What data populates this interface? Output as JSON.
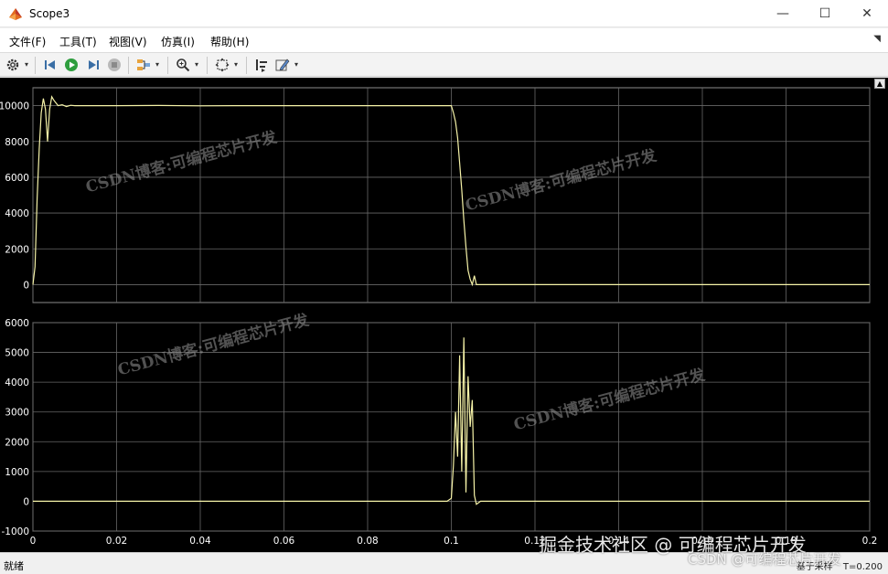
{
  "window": {
    "title": "Scope3",
    "minimize": "—",
    "maximize": "☐",
    "close": "✕"
  },
  "menu": [
    {
      "label": "文件(F)"
    },
    {
      "label": "工具(T)"
    },
    {
      "label": "视图(V)"
    },
    {
      "label": "仿真(I)"
    },
    {
      "label": "帮助(H)"
    }
  ],
  "menu_corner": "◥",
  "toolbar": {
    "icons": [
      "gear-icon",
      "step-back-icon",
      "run-icon",
      "step-forward-icon",
      "stop-icon",
      "signal-highlight-icon",
      "zoom-icon",
      "fit-to-view-icon",
      "cursor-measure-icon",
      "style-pen-icon"
    ]
  },
  "colors": {
    "trace": "#f6f3a8",
    "grid": "#686868",
    "axes_bg": "#000000",
    "tick_text": "#ffffff"
  },
  "chart_data": [
    {
      "type": "line",
      "title": "",
      "xlabel": "",
      "ylabel": "",
      "xlim": [
        0,
        0.2
      ],
      "ylim": [
        -1000,
        11000
      ],
      "xticks": [
        0,
        0.02,
        0.04,
        0.06,
        0.08,
        0.1,
        0.12,
        0.14,
        0.16,
        0.18,
        0.2
      ],
      "yticks": [
        0,
        2000,
        4000,
        6000,
        8000,
        10000
      ],
      "grid": true,
      "series": [
        {
          "x": [
            0,
            0.0005,
            0.001,
            0.0015,
            0.002,
            0.0025,
            0.003,
            0.0035,
            0.004,
            0.0045,
            0.005,
            0.0055,
            0.006,
            0.007,
            0.008,
            0.009,
            0.01,
            0.02,
            0.03,
            0.04,
            0.05,
            0.06,
            0.07,
            0.08,
            0.09,
            0.1,
            0.1005,
            0.101,
            0.1015,
            0.102,
            0.1025,
            0.103,
            0.1035,
            0.104,
            0.1045,
            0.105,
            0.1055,
            0.106,
            0.11,
            0.12,
            0.14,
            0.16,
            0.18,
            0.2
          ],
          "y": [
            0,
            1000,
            4800,
            7600,
            9600,
            10400,
            9800,
            8000,
            9800,
            10500,
            10300,
            10150,
            10000,
            10050,
            9950,
            10020,
            10000,
            10000,
            10010,
            9990,
            10000,
            10000,
            10000,
            10000,
            10000,
            10000,
            9600,
            9100,
            8200,
            6800,
            5300,
            3600,
            2100,
            800,
            300,
            0,
            500,
            0,
            0,
            0,
            0,
            0,
            0,
            0
          ]
        }
      ]
    },
    {
      "type": "line",
      "title": "",
      "xlabel": "",
      "ylabel": "",
      "xlim": [
        0,
        0.2
      ],
      "ylim": [
        -1000,
        6000
      ],
      "xticks": [
        0,
        0.02,
        0.04,
        0.06,
        0.08,
        0.1,
        0.12,
        0.14,
        0.16,
        0.18,
        0.2
      ],
      "x_tick_labels": [
        "0",
        "0.02",
        "0.04",
        "0.06",
        "0.08",
        "0.1",
        "0.12",
        "0.14",
        "0.16",
        "0.18",
        "0.2"
      ],
      "yticks": [
        -1000,
        0,
        1000,
        2000,
        3000,
        4000,
        5000,
        6000
      ],
      "grid": true,
      "series": [
        {
          "x": [
            0,
            0.099,
            0.1,
            0.1005,
            0.101,
            0.1015,
            0.102,
            0.1025,
            0.103,
            0.1035,
            0.104,
            0.1045,
            0.105,
            0.1055,
            0.106,
            0.107,
            0.12,
            0.2
          ],
          "y": [
            0,
            0,
            100,
            1200,
            3000,
            1500,
            4900,
            1000,
            5500,
            300,
            4200,
            2500,
            3400,
            200,
            -100,
            0,
            0,
            0
          ]
        }
      ]
    }
  ],
  "status": {
    "left": "就绪",
    "right_mode": "基于采样",
    "right_time": "T=0.200"
  },
  "watermarks": {
    "plot": [
      "CSDN博客:可编程芯片开发",
      "CSDN博客:可编程芯片开发",
      "CSDN博客:可编程芯片开发",
      "CSDN博客:可编程芯片开发"
    ],
    "site": "掘金技术社区 @ 可编程芯片开发",
    "site2": "CSDN @可编程芯片开发"
  }
}
